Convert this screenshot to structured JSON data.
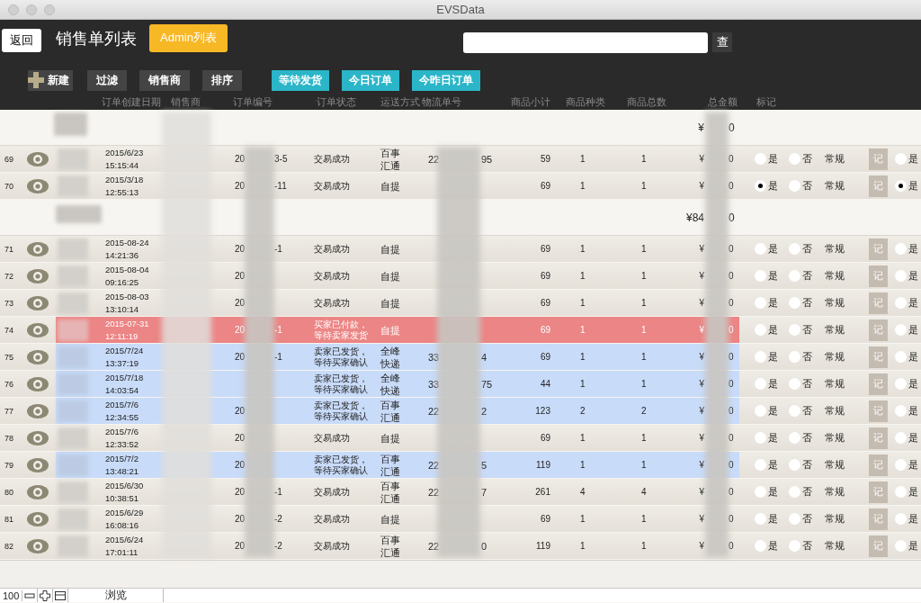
{
  "window": {
    "title": "EVSData"
  },
  "toolbar": {
    "back_button": "返回",
    "title": "销售单列表",
    "admin_button": "Admin列表",
    "search_button": "查"
  },
  "actions": [
    {
      "label": "新建",
      "kind": "add"
    },
    {
      "label": "过滤",
      "kind": "plain"
    },
    {
      "label": "销售商",
      "kind": "plain"
    },
    {
      "label": "排序",
      "kind": "plain"
    },
    {
      "label": "等待发货",
      "kind": "quick"
    },
    {
      "label": "今日订单",
      "kind": "quick"
    },
    {
      "label": "今昨日订单",
      "kind": "quick"
    }
  ],
  "columns": [
    "订单创建日期",
    "销售商",
    "订单编号",
    "订单状态",
    "运送方式",
    "物流单号",
    "商品小计",
    "商品种类",
    "商品总数",
    "总金额",
    "标记"
  ],
  "groups": [
    {
      "total_prefix": "¥",
      "total_suffix": "0",
      "rows": [
        {
          "row_number": "69",
          "date": "2015/6/23\n15:15:44",
          "order_prefix": "20",
          "order_suffix": "3-5",
          "status": "交易成功",
          "shipping": "百事汇通",
          "tracking_prefix": "22",
          "tracking_suffix": "95",
          "subtotal": "59",
          "kinds": "1",
          "quantity": "1",
          "amount_prefix": "¥",
          "amount_suffix": "0",
          "kind": "done",
          "options": [
            {
              "label": "是",
              "selected": false
            },
            {
              "label": "否",
              "selected": false
            }
          ],
          "category": "常规",
          "mark_button": "记",
          "extra_option": {
            "label": "是",
            "selected": false
          }
        },
        {
          "row_number": "70",
          "date": "2015/3/18\n12:55:13",
          "order_prefix": "20",
          "order_suffix": "-11",
          "status": "交易成功",
          "shipping": "自提",
          "subtotal": "69",
          "kinds": "1",
          "quantity": "1",
          "amount_prefix": "¥",
          "amount_suffix": "0",
          "kind": "done",
          "options": [
            {
              "label": "是",
              "selected": true
            },
            {
              "label": "否",
              "selected": false
            }
          ],
          "category": "常规",
          "mark_button": "记",
          "extra_option": {
            "label": "是",
            "selected": true
          }
        }
      ]
    },
    {
      "total_prefix": "¥84",
      "total_suffix": "0",
      "rows": [
        {
          "row_number": "71",
          "date": "2015-08-24\n14:21:36",
          "order_prefix": "20",
          "order_suffix": "-1",
          "status": "交易成功",
          "shipping": "自提",
          "subtotal": "69",
          "kinds": "1",
          "quantity": "1",
          "amount_prefix": "¥",
          "amount_suffix": "0",
          "kind": "done",
          "options": [
            {
              "label": "是",
              "selected": false
            },
            {
              "label": "否",
              "selected": false
            }
          ],
          "category": "常规",
          "mark_button": "记",
          "extra_option": {
            "label": "是",
            "selected": false
          }
        },
        {
          "row_number": "72",
          "date": "2015-08-04\n09:16:25",
          "order_prefix": "20",
          "status": "交易成功",
          "shipping": "自提",
          "subtotal": "69",
          "kinds": "1",
          "quantity": "1",
          "amount_prefix": "¥",
          "amount_suffix": "0",
          "kind": "done",
          "options": [
            {
              "label": "是",
              "selected": false
            },
            {
              "label": "否",
              "selected": false
            }
          ],
          "category": "常规",
          "mark_button": "记",
          "extra_option": {
            "label": "是",
            "selected": false
          }
        },
        {
          "row_number": "73",
          "date": "2015-08-03\n13:10:14",
          "order_prefix": "20",
          "status": "交易成功",
          "shipping": "自提",
          "subtotal": "69",
          "kinds": "1",
          "quantity": "1",
          "amount_prefix": "¥",
          "amount_suffix": "0",
          "kind": "done",
          "options": [
            {
              "label": "是",
              "selected": false
            },
            {
              "label": "否",
              "selected": false
            }
          ],
          "category": "常规",
          "mark_button": "记",
          "extra_option": {
            "label": "是",
            "selected": false
          }
        },
        {
          "row_number": "74",
          "date": "2015-07-31\n12:11:19",
          "order_prefix": "20",
          "order_suffix": "-1",
          "status": "买家已付款，等待卖家发货",
          "shipping": "自提",
          "subtotal": "69",
          "kinds": "1",
          "quantity": "1",
          "amount_prefix": "¥",
          "amount_suffix": "0",
          "kind": "paid",
          "options": [
            {
              "label": "是",
              "selected": false
            },
            {
              "label": "否",
              "selected": false
            }
          ],
          "category": "常规",
          "mark_button": "记",
          "extra_option": {
            "label": "是",
            "selected": false
          }
        },
        {
          "row_number": "75",
          "date": "2015/7/24\n13:37:19",
          "order_prefix": "20",
          "order_suffix": "-1",
          "status": "卖家已发货，等待买家确认",
          "shipping": "全峰快递",
          "tracking_prefix": "33",
          "tracking_suffix": "4",
          "subtotal": "69",
          "kinds": "1",
          "quantity": "1",
          "amount_prefix": "¥",
          "amount_suffix": "0",
          "kind": "shipped",
          "options": [
            {
              "label": "是",
              "selected": false
            },
            {
              "label": "否",
              "selected": false
            }
          ],
          "category": "常规",
          "mark_button": "记",
          "extra_option": {
            "label": "是",
            "selected": false
          }
        },
        {
          "row_number": "76",
          "date": "2015/7/18\n14:03:54",
          "status": "卖家已发货，等待买家确认",
          "shipping": "全峰快递",
          "tracking_prefix": "33",
          "tracking_suffix": "75",
          "subtotal": "44",
          "kinds": "1",
          "quantity": "1",
          "amount_prefix": "¥",
          "amount_suffix": "0",
          "kind": "shipped",
          "options": [
            {
              "label": "是",
              "selected": false
            },
            {
              "label": "否",
              "selected": false
            }
          ],
          "category": "常规",
          "mark_button": "记",
          "extra_option": {
            "label": "是",
            "selected": false
          }
        },
        {
          "row_number": "77",
          "date": "2015/7/6\n12:34:55",
          "order_prefix": "20",
          "status": "卖家已发货，等待买家确认",
          "shipping": "百事汇通",
          "tracking_prefix": "22",
          "tracking_suffix": "2",
          "subtotal": "123",
          "kinds": "2",
          "quantity": "2",
          "amount_prefix": "¥",
          "amount_suffix": "0",
          "kind": "shipped",
          "options": [
            {
              "label": "是",
              "selected": false
            },
            {
              "label": "否",
              "selected": false
            }
          ],
          "category": "常规",
          "mark_button": "记",
          "extra_option": {
            "label": "是",
            "selected": false
          }
        },
        {
          "row_number": "78",
          "date": "2015/7/6\n12:33:52",
          "order_prefix": "20",
          "status": "交易成功",
          "shipping": "自提",
          "subtotal": "69",
          "kinds": "1",
          "quantity": "1",
          "amount_prefix": "¥",
          "amount_suffix": "0",
          "kind": "done",
          "options": [
            {
              "label": "是",
              "selected": false
            },
            {
              "label": "否",
              "selected": false
            }
          ],
          "category": "常规",
          "mark_button": "记",
          "extra_option": {
            "label": "是",
            "selected": false
          }
        },
        {
          "row_number": "79",
          "date": "2015/7/2\n13:48:21",
          "order_prefix": "20",
          "status": "卖家已发货，等待买家确认",
          "shipping": "百事汇通",
          "tracking_prefix": "22",
          "tracking_suffix": "5",
          "subtotal": "119",
          "kinds": "1",
          "quantity": "1",
          "amount_prefix": "¥",
          "amount_suffix": "0",
          "kind": "shipped",
          "options": [
            {
              "label": "是",
              "selected": false
            },
            {
              "label": "否",
              "selected": false
            }
          ],
          "category": "常规",
          "mark_button": "记",
          "extra_option": {
            "label": "是",
            "selected": false
          }
        },
        {
          "row_number": "80",
          "date": "2015/6/30\n10:38:51",
          "order_prefix": "20",
          "order_suffix": "-1",
          "status": "交易成功",
          "shipping": "百事汇通",
          "tracking_prefix": "22",
          "tracking_suffix": "7",
          "subtotal": "261",
          "kinds": "4",
          "quantity": "4",
          "amount_prefix": "¥",
          "amount_suffix": "0",
          "kind": "done",
          "options": [
            {
              "label": "是",
              "selected": false
            },
            {
              "label": "否",
              "selected": false
            }
          ],
          "category": "常规",
          "mark_button": "记",
          "extra_option": {
            "label": "是",
            "selected": false
          }
        },
        {
          "row_number": "81",
          "date": "2015/6/29\n16:08:16",
          "order_prefix": "20",
          "order_suffix": "-2",
          "status": "交易成功",
          "shipping": "自提",
          "subtotal": "69",
          "kinds": "1",
          "quantity": "1",
          "amount_prefix": "¥",
          "amount_suffix": "0",
          "kind": "done",
          "options": [
            {
              "label": "是",
              "selected": false
            },
            {
              "label": "否",
              "selected": false
            }
          ],
          "category": "常规",
          "mark_button": "记",
          "extra_option": {
            "label": "是",
            "selected": false
          }
        },
        {
          "row_number": "82",
          "date": "2015/6/24\n17:01:11",
          "order_prefix": "20",
          "order_suffix": "-2",
          "status": "交易成功",
          "shipping": "百事汇通",
          "tracking_prefix": "22",
          "tracking_suffix": "0",
          "subtotal": "119",
          "kinds": "1",
          "quantity": "1",
          "amount_prefix": "¥",
          "amount_suffix": "0",
          "kind": "done",
          "options": [
            {
              "label": "是",
              "selected": false
            },
            {
              "label": "否",
              "selected": false
            }
          ],
          "category": "常规",
          "mark_button": "记",
          "extra_option": {
            "label": "是",
            "selected": false
          }
        }
      ]
    }
  ],
  "status_bar": {
    "zoom": "100",
    "mode": "浏览"
  }
}
